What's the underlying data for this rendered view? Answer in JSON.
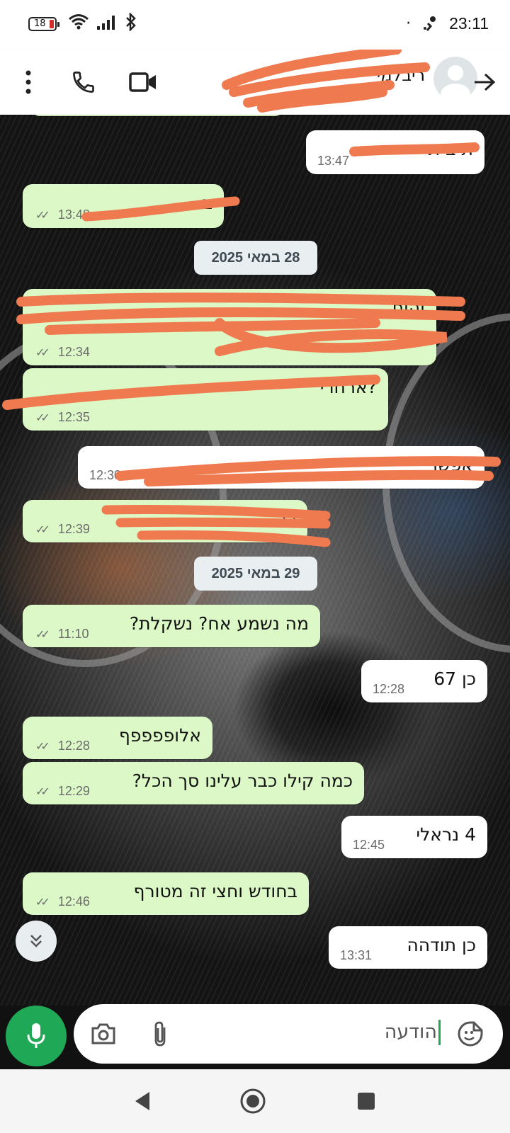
{
  "status_bar": {
    "battery": "18",
    "time": "23:11",
    "dot": "·"
  },
  "header": {
    "contact_name": "ריבלמי",
    "icons": [
      "more-icon",
      "phone-icon",
      "video-icon",
      "back-arrow-icon"
    ]
  },
  "messages": [
    {
      "dir": "in",
      "text": "ת ב ת",
      "time": "13:47"
    },
    {
      "dir": "out",
      "text": "ב",
      "time": "13:48",
      "read": true
    },
    {
      "dir": "out",
      "text": "והוח",
      "time": "12:34",
      "read": true
    },
    {
      "dir": "out",
      "text": "?ארחרי",
      "time": "12:35",
      "read": true
    },
    {
      "dir": "in",
      "text": "אפשר",
      "time": "12:30"
    },
    {
      "dir": "out",
      "text": "כה",
      "time": "12:39",
      "read": true
    },
    {
      "dir": "out",
      "text": "מה נשמע אח? נשקלת?",
      "time": "11:10",
      "read": true
    },
    {
      "dir": "in",
      "text": "כן 67",
      "time": "12:28"
    },
    {
      "dir": "out",
      "text": "אלופפפפף",
      "time": "12:28",
      "read": true
    },
    {
      "dir": "out",
      "text": "כמה קילו כבר עלינו סך הכל?",
      "time": "12:29",
      "read": true
    },
    {
      "dir": "in",
      "text": "4 נראלי",
      "time": "12:45"
    },
    {
      "dir": "out",
      "text": "בחודש וחצי זה מטורף",
      "time": "12:46",
      "read": true
    },
    {
      "dir": "in",
      "text": "כן תודהה",
      "time": "13:31"
    }
  ],
  "date_chips": [
    "28 במאי 2025",
    "29 במאי 2025"
  ],
  "composer": {
    "placeholder": "הודעה",
    "icons": [
      "emoji-icon",
      "attach-icon",
      "camera-icon",
      "mic-icon"
    ]
  },
  "colors": {
    "outgoing_bubble": "#dcf8c6",
    "incoming_bubble": "#ffffff",
    "accent_green": "#1fa855",
    "redaction": "#f07a4f"
  }
}
